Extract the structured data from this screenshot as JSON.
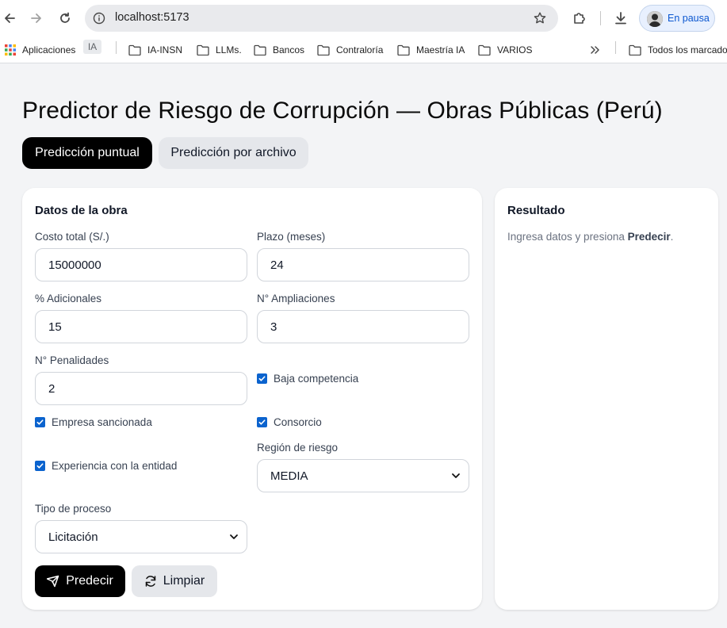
{
  "browser": {
    "url": "localhost:5173",
    "profile_label": "En pausa",
    "bookmarks": {
      "apps_label": "Aplicaciones",
      "ia_label": "IA",
      "items": [
        "IA-INSN",
        "LLMs.",
        "Bancos",
        "Contraloría",
        "Maestría IA",
        "VARIOS"
      ],
      "all_label": "Todos los marcado"
    }
  },
  "page": {
    "title": "Predictor de Riesgo de Corrupción — Obras Públicas (Perú)",
    "tabs": [
      {
        "label": "Predicción puntual",
        "active": true
      },
      {
        "label": "Predicción por archivo",
        "active": false
      }
    ]
  },
  "form": {
    "title": "Datos de la obra",
    "costo_label": "Costo total (S/.)",
    "costo_value": "15000000",
    "plazo_label": "Plazo (meses)",
    "plazo_value": "24",
    "adicionales_label": "% Adicionales",
    "adicionales_value": "15",
    "ampliaciones_label": "N° Ampliaciones",
    "ampliaciones_value": "3",
    "penalidades_label": "N° Penalidades",
    "penalidades_value": "2",
    "baja_competencia_label": "Baja competencia",
    "baja_competencia_checked": true,
    "empresa_sancionada_label": "Empresa sancionada",
    "empresa_sancionada_checked": true,
    "consorcio_label": "Consorcio",
    "consorcio_checked": true,
    "experiencia_label": "Experiencia con la entidad",
    "experiencia_checked": true,
    "region_label": "Región de riesgo",
    "region_value": "MEDIA",
    "tipo_label": "Tipo de proceso",
    "tipo_value": "Licitación",
    "predict_label": "Predecir",
    "clear_label": "Limpiar"
  },
  "result": {
    "title": "Resultado",
    "hint_prefix": "Ingresa datos y presiona ",
    "hint_bold": "Predecir",
    "hint_suffix": "."
  },
  "colors": {
    "accent": "#000000",
    "checkbox": "#0b63ce",
    "secondary_bg": "#e5e7eb",
    "page_bg": "#f3f4f6"
  }
}
